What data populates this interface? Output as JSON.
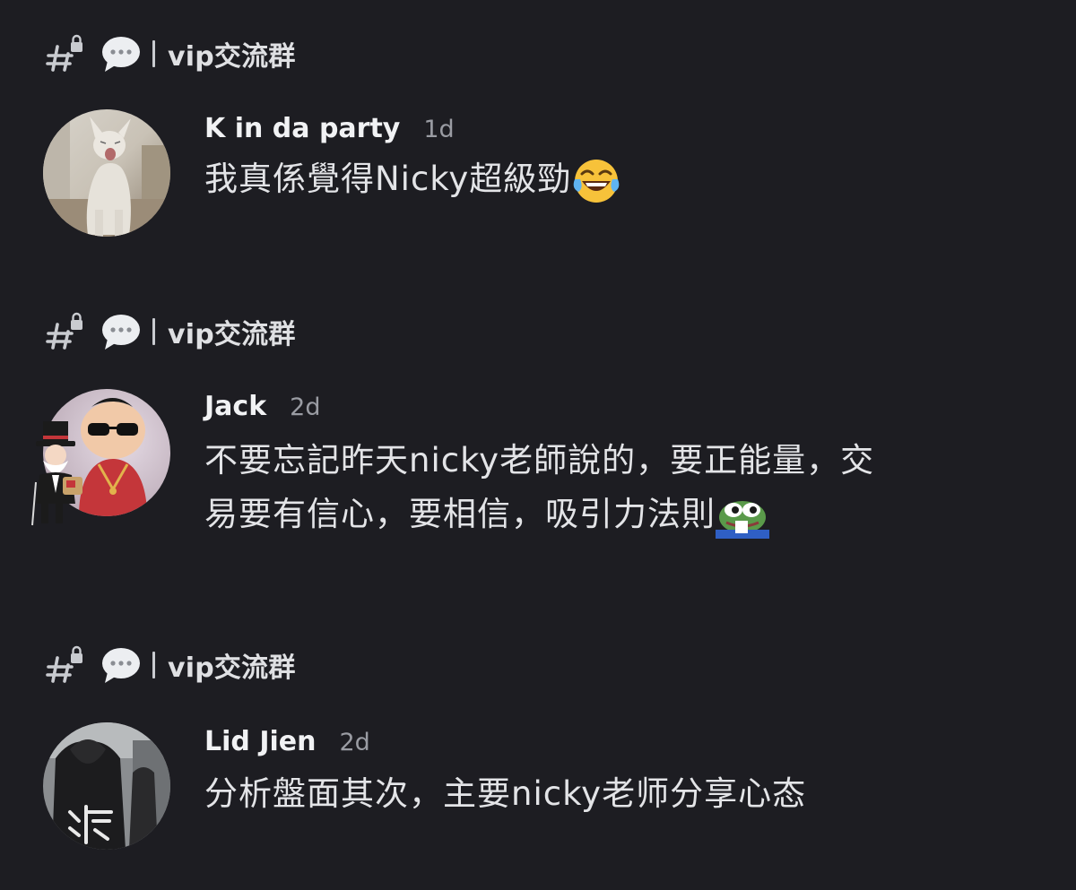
{
  "feed": [
    {
      "channel": {
        "name": "vip交流群",
        "icons": [
          "hash-lock-icon",
          "speech-bubble-icon"
        ]
      },
      "message": {
        "username": "K in da party",
        "timestamp": "1d",
        "text": "我真係覺得Nicky超級勁",
        "emoji": "tears-of-joy-emoji",
        "avatar": "cat-avatar"
      }
    },
    {
      "channel": {
        "name": "vip交流群",
        "icons": [
          "hash-lock-icon",
          "speech-bubble-icon"
        ]
      },
      "message": {
        "username": "Jack",
        "timestamp": "2d",
        "text_line1": "不要忘記昨天nicky老師說的，要正能量，交",
        "text_line2": "易要有信心，要相信，吸引力法則",
        "emoji": "pepe-frog-emoji",
        "avatar": "baby-with-sunglasses-avatar",
        "badge": "monopoly-man-badge"
      }
    },
    {
      "channel": {
        "name": "vip交流群",
        "icons": [
          "hash-lock-icon",
          "speech-bubble-icon"
        ]
      },
      "message": {
        "username": "Lid Jien",
        "timestamp": "2d",
        "text": "分析盤面其次，主要nicky老师分享心态",
        "avatar": "hoodie-avatar"
      }
    }
  ],
  "colors": {
    "background": "#1d1d22",
    "username": "#f1f2f4",
    "timestamp": "#9a9ca3",
    "text": "#e3e4e7"
  }
}
